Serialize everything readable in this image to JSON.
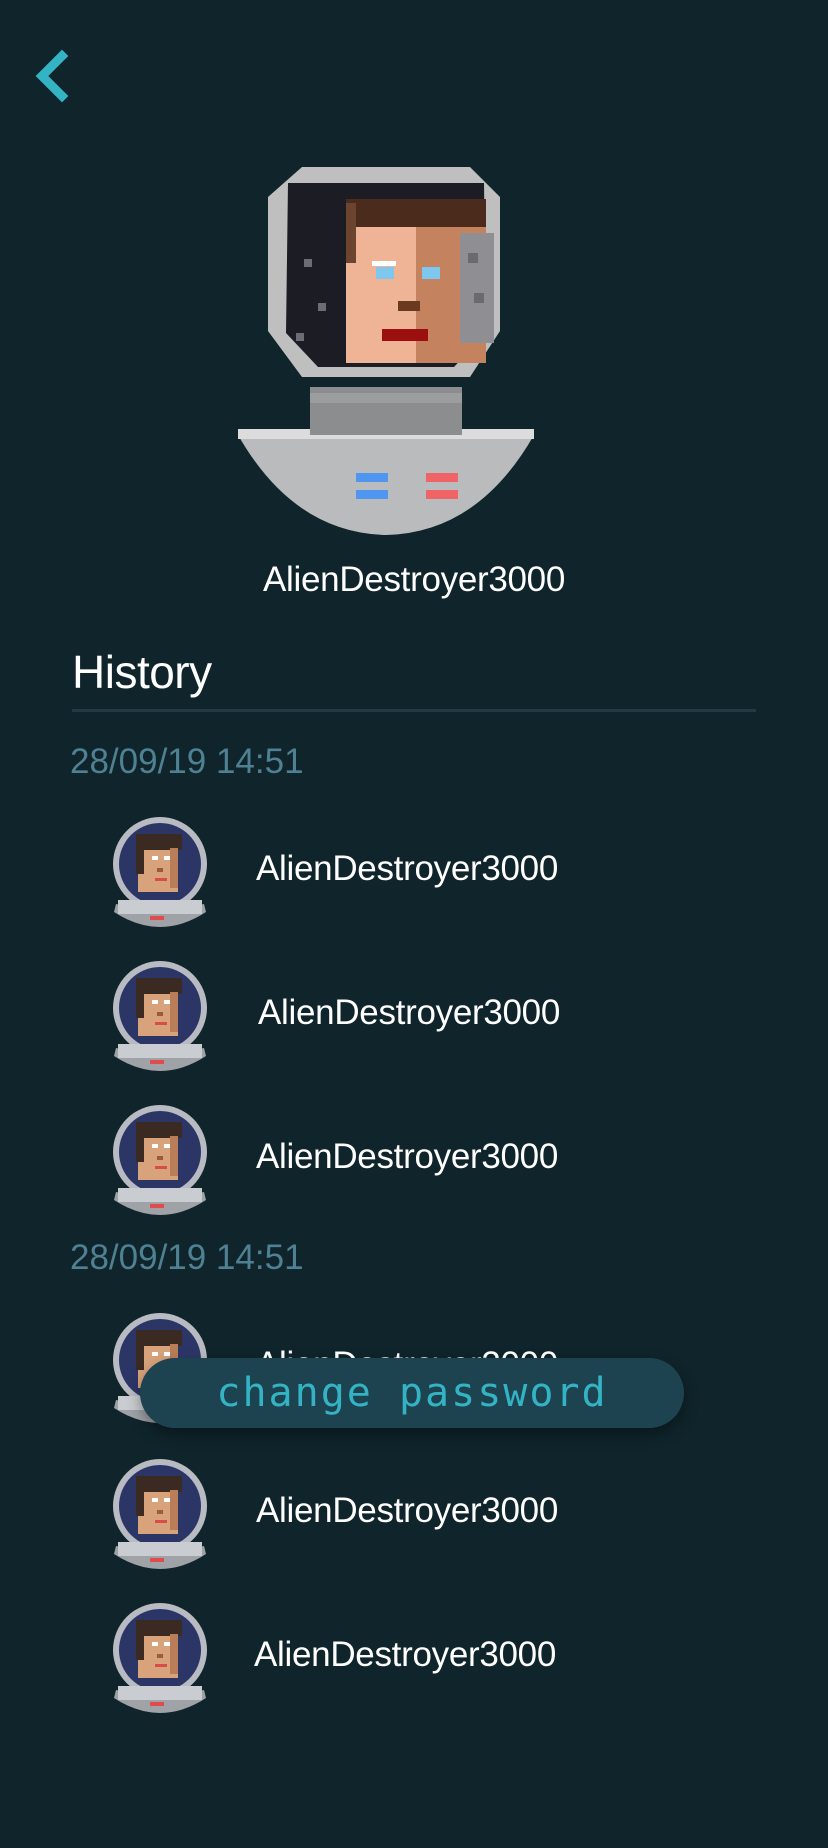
{
  "nav": {
    "back_icon": "chevron-left-icon"
  },
  "profile": {
    "username": "AlienDestroyer3000",
    "avatar_icon": "astronaut-avatar-icon"
  },
  "history": {
    "title": "History",
    "groups": [
      {
        "date": "28/09/19 14:51",
        "entries": [
          {
            "name": "AlienDestroyer3000"
          },
          {
            "name": "AlienDestroyer3000"
          },
          {
            "name": "AlienDestroyer3000"
          }
        ]
      },
      {
        "date": "28/09/19 14:51",
        "entries": [
          {
            "name": "AlienDestroyer3000"
          },
          {
            "name": "AlienDestroyer3000"
          },
          {
            "name": "AlienDestroyer3000"
          }
        ]
      }
    ]
  },
  "actions": {
    "change_password": "change password"
  },
  "colors": {
    "background": "#0f242b",
    "accent": "#33b3c3",
    "date_text": "#4f8193",
    "button_bg": "#1d4250"
  }
}
